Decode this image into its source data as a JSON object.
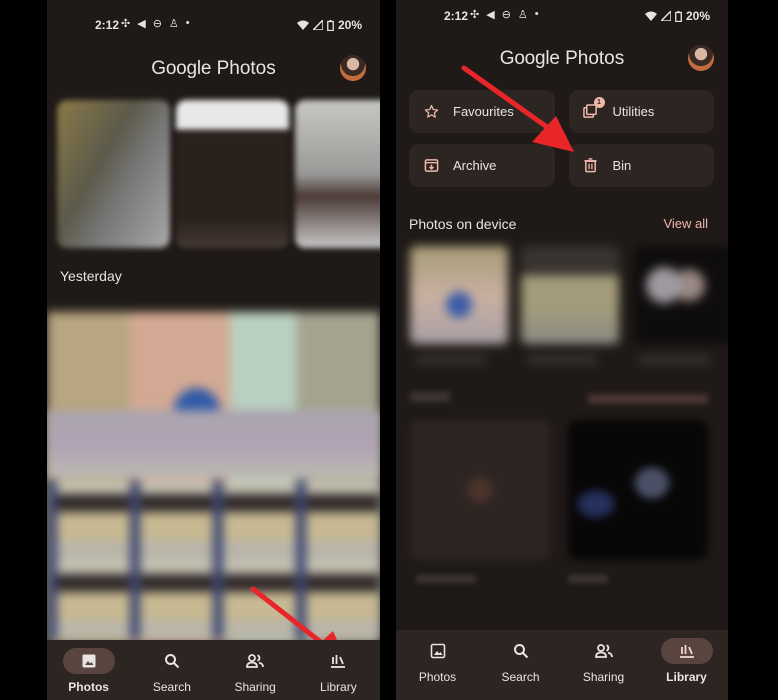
{
  "status_bar": {
    "time": "2:12",
    "notification_icons": [
      "slack-icon",
      "telegram-icon",
      "messenger-icon",
      "robot-icon",
      "dot-icon"
    ],
    "battery": "20%"
  },
  "app": {
    "title_google": "Google",
    "title_photos": "Photos"
  },
  "left_screen": {
    "section_label": "Yesterday",
    "nav": [
      {
        "label": "Photos",
        "icon": "photo-icon",
        "active": true
      },
      {
        "label": "Search",
        "icon": "search-icon",
        "active": false
      },
      {
        "label": "Sharing",
        "icon": "people-icon",
        "active": false
      },
      {
        "label": "Library",
        "icon": "library-icon",
        "active": false
      }
    ]
  },
  "right_screen": {
    "library_buttons": [
      {
        "label": "Favourites",
        "icon": "star-icon"
      },
      {
        "label": "Utilities",
        "icon": "utilities-icon",
        "badge": "1"
      },
      {
        "label": "Archive",
        "icon": "archive-icon"
      },
      {
        "label": "Bin",
        "icon": "trash-icon"
      }
    ],
    "section_label": "Photos on device",
    "view_all": "View all",
    "nav": [
      {
        "label": "Photos",
        "icon": "photo-icon",
        "active": false
      },
      {
        "label": "Search",
        "icon": "search-icon",
        "active": false
      },
      {
        "label": "Sharing",
        "icon": "people-icon",
        "active": false
      },
      {
        "label": "Library",
        "icon": "library-icon",
        "active": true
      }
    ]
  },
  "annotations": {
    "arrow_color": "#e8262a",
    "accent_color": "#f0b8a8"
  }
}
